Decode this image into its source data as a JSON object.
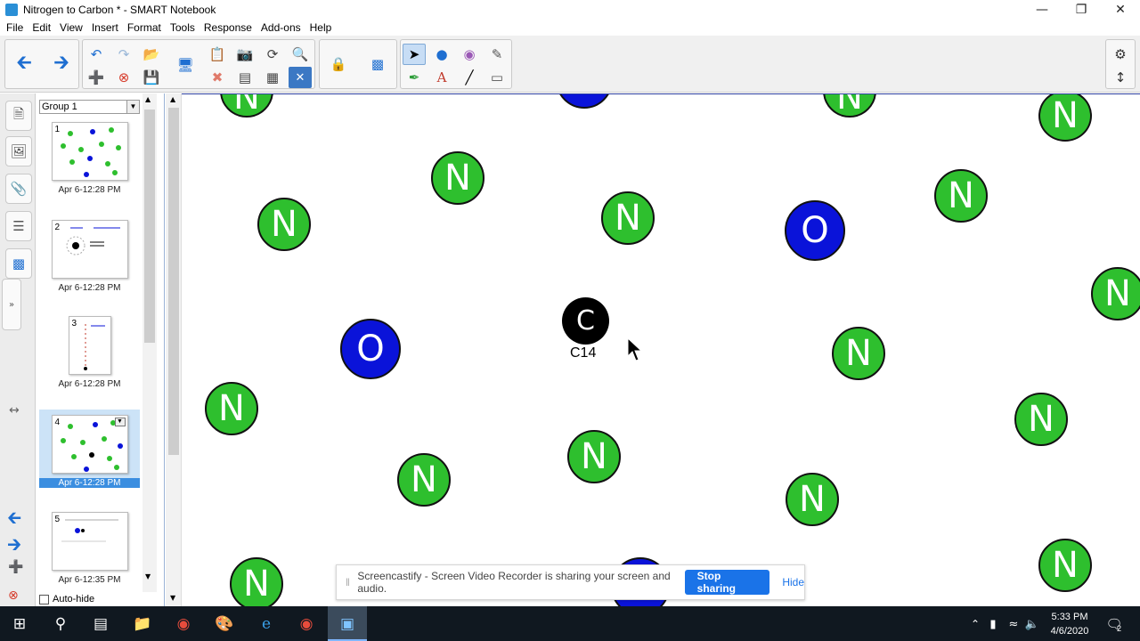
{
  "window": {
    "title": "Nitrogen to Carbon * - SMART Notebook",
    "minimize_icon": "minimize-icon",
    "restore_icon": "restore-icon",
    "close_icon": "close-icon"
  },
  "menu": [
    "File",
    "Edit",
    "View",
    "Insert",
    "Format",
    "Tools",
    "Response",
    "Add-ons",
    "Help"
  ],
  "toolbar": {
    "icons": [
      "back-arrow-icon",
      "forward-arrow-icon",
      "undo-icon",
      "redo-icon",
      "open-icon",
      "add-page-icon",
      "delete-page-icon",
      "save-icon",
      "display-icon",
      "paste-icon",
      "screenshot-icon",
      "reset-icon",
      "search-icon",
      "delete-icon",
      "screen-shade-icon",
      "table-icon",
      "close-icon",
      "lock-icon",
      "addons-icon",
      "select-icon",
      "shapes-icon",
      "fill-icon",
      "magic-pen-icon",
      "pens-icon",
      "text-icon",
      "line-icon",
      "eraser-icon",
      "settings-icon",
      "move-toolbar-icon"
    ]
  },
  "sidebar_tabs": [
    "page-sorter-icon",
    "gallery-icon",
    "attachments-icon",
    "properties-icon",
    "addons-icon"
  ],
  "sorter": {
    "group_label": "Group 1",
    "autohide_label": "Auto-hide",
    "pages": [
      {
        "num": "1",
        "date": "Apr 6-12:28 PM"
      },
      {
        "num": "2",
        "date": "Apr 6-12:28 PM"
      },
      {
        "num": "3",
        "date": "Apr 6-12:28 PM"
      },
      {
        "num": "4",
        "date": "Apr 6-12:28 PM"
      },
      {
        "num": "5",
        "date": "Apr 6-12:35 PM"
      }
    ]
  },
  "canvas": {
    "nitrogen_label": "N",
    "oxygen_label": "O",
    "carbon_label": "C",
    "carbon_caption": "C14",
    "colors": {
      "nitrogen": "#2ebf2e",
      "oxygen": "#0a13d9",
      "carbon": "#000000"
    }
  },
  "share_bar": {
    "message": "Screencastify - Screen Video Recorder is sharing your screen and audio.",
    "stop_label": "Stop sharing",
    "hide_label": "Hide"
  },
  "taskbar": {
    "time": "5:33 PM",
    "date": "4/6/2020",
    "notification_count": "2"
  }
}
